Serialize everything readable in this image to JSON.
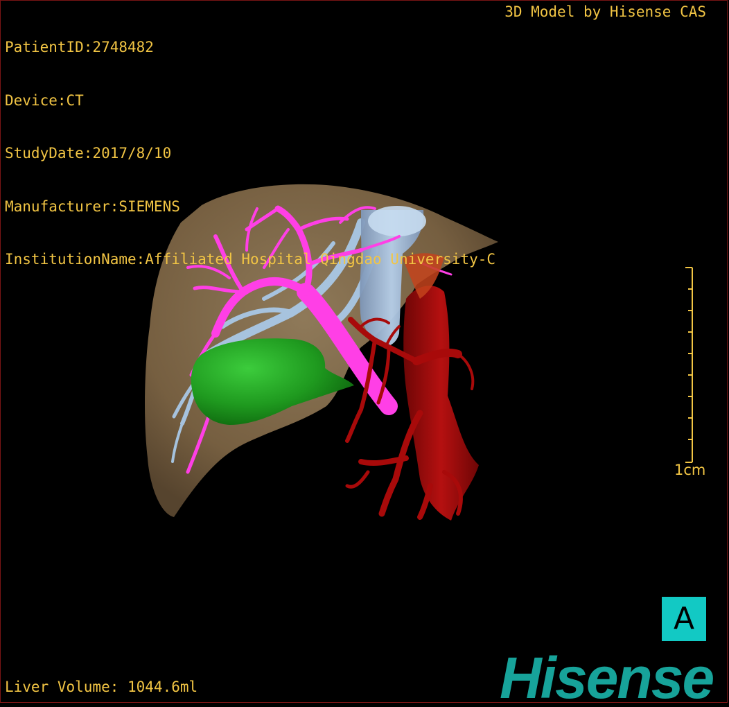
{
  "header": {
    "patient_id": "PatientID:2748482",
    "device": "Device:CT",
    "study_date": "StudyDate:2017/8/10",
    "manufacturer": "Manufacturer:SIEMENS",
    "institution": "InstitutionName:Affiliated Hospital Qingdao University-C"
  },
  "brand_model": "3D Model by Hisense CAS",
  "scale": {
    "label": "1cm"
  },
  "orientation": {
    "label": "A",
    "color": "#12c9c4"
  },
  "footer": {
    "liver_volume": "Liver Volume: 1044.6ml"
  },
  "logo": {
    "text": "Hisense",
    "color": "#17a39a"
  },
  "colors": {
    "overlay_text": "#f2c544",
    "liver": "#8a7150",
    "portal_vein": "#ff3fe6",
    "hepatic_vein": "#a9c8e6",
    "artery": "#a80a0a",
    "gallbladder_tumor": "#1e9a1e",
    "frame_border": "#7a1414"
  },
  "structures": [
    "liver",
    "portal-vein",
    "hepatic-vein",
    "artery",
    "gallbladder",
    "vena-cava"
  ]
}
